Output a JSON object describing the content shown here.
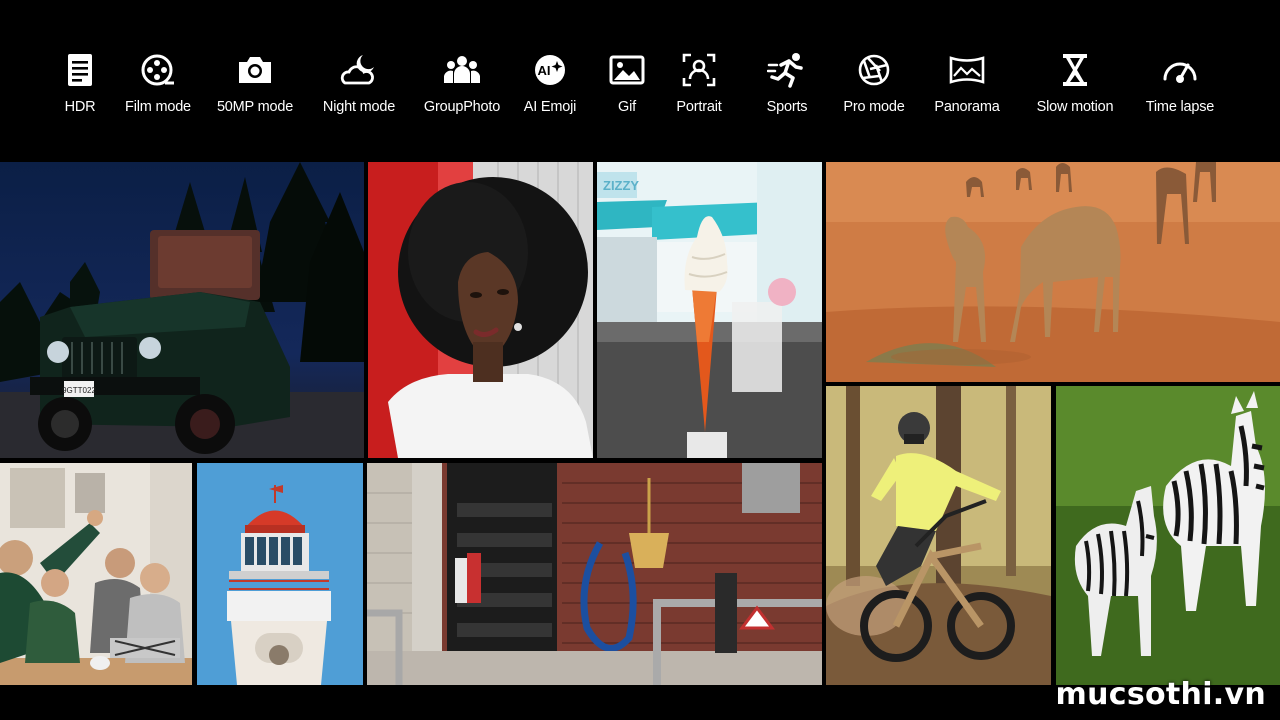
{
  "modes": [
    {
      "label": "HDR",
      "icon": "document-icon"
    },
    {
      "label": "Film mode",
      "icon": "film-reel-icon"
    },
    {
      "label": "50MP mode",
      "icon": "camera-icon"
    },
    {
      "label": "Night mode",
      "icon": "moon-cloud-icon"
    },
    {
      "label": "GroupPhoto",
      "icon": "group-icon"
    },
    {
      "label": "AI Emoji",
      "icon": "ai-emoji-icon"
    },
    {
      "label": "Gif",
      "icon": "image-icon"
    },
    {
      "label": "Portrait",
      "icon": "portrait-icon"
    },
    {
      "label": "Sports",
      "icon": "running-icon"
    },
    {
      "label": "Pro mode",
      "icon": "aperture-icon"
    },
    {
      "label": "Panorama",
      "icon": "panorama-icon"
    },
    {
      "label": "Slow motion",
      "icon": "hourglass-icon"
    },
    {
      "label": "Time lapse",
      "icon": "speedometer-icon"
    }
  ],
  "photos": {
    "jeep_plate": "9GTT022",
    "sign_text": "ZIZZY"
  },
  "watermark": "mucsothi.vn",
  "colors": {
    "background": "#000000",
    "text": "#ffffff"
  }
}
